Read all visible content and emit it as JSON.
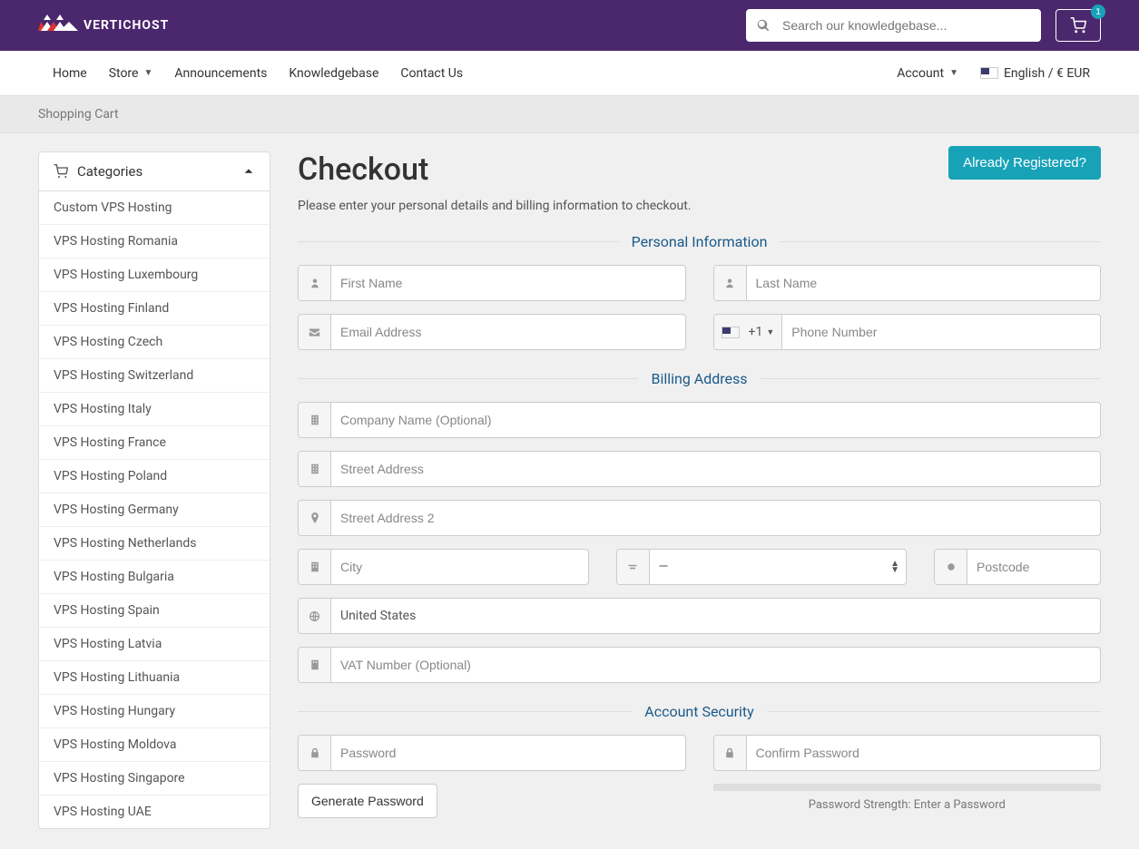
{
  "header": {
    "brand": "VERTICHOST",
    "search_placeholder": "Search our knowledgebase...",
    "cart_count": "1"
  },
  "nav": {
    "home": "Home",
    "store": "Store",
    "announcements": "Announcements",
    "knowledgebase": "Knowledgebase",
    "contact": "Contact Us",
    "account": "Account",
    "locale": "English / € EUR"
  },
  "breadcrumb": "Shopping Cart",
  "sidebar": {
    "title": "Categories",
    "items": [
      "Custom VPS Hosting",
      "VPS Hosting Romania",
      "VPS Hosting Luxembourg",
      "VPS Hosting Finland",
      "VPS Hosting Czech",
      "VPS Hosting Switzerland",
      "VPS Hosting Italy",
      "VPS Hosting France",
      "VPS Hosting Poland",
      "VPS Hosting Germany",
      "VPS Hosting Netherlands",
      "VPS Hosting Bulgaria",
      "VPS Hosting Spain",
      "VPS Hosting Latvia",
      "VPS Hosting Lithuania",
      "VPS Hosting Hungary",
      "VPS Hosting Moldova",
      "VPS Hosting Singapore",
      "VPS Hosting UAE"
    ]
  },
  "main": {
    "title": "Checkout",
    "subtitle": "Please enter your personal details and billing information to checkout.",
    "already": "Already Registered?",
    "sections": {
      "personal": "Personal Information",
      "billing": "Billing Address",
      "security": "Account Security"
    },
    "fields": {
      "first_name": "First Name",
      "last_name": "Last Name",
      "email": "Email Address",
      "phone_prefix": "+1",
      "phone": "Phone Number",
      "company": "Company Name (Optional)",
      "street1": "Street Address",
      "street2": "Street Address 2",
      "city": "City",
      "state": "—",
      "postcode": "Postcode",
      "country": "United States",
      "vat": "VAT Number (Optional)",
      "password": "Password",
      "confirm": "Confirm Password",
      "generate": "Generate Password",
      "strength": "Password Strength: Enter a Password"
    }
  }
}
